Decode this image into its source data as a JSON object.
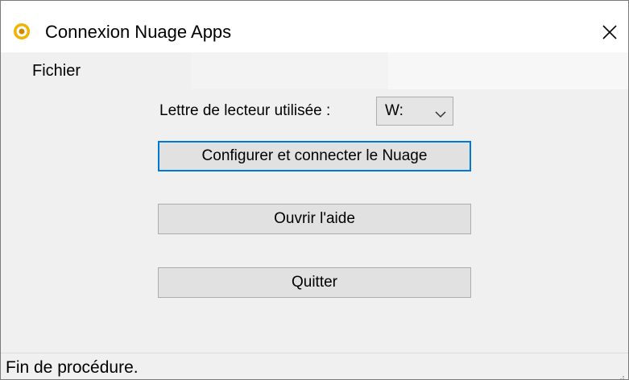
{
  "window": {
    "title": "Connexion Nuage Apps",
    "icon": "app-logo-icon",
    "close_icon": "close-icon"
  },
  "menu": {
    "items": [
      {
        "label": "Fichier"
      }
    ]
  },
  "drive": {
    "label": "Lettre de lecteur utilisée :",
    "selected": "W:"
  },
  "buttons": {
    "configure": "Configurer et connecter le Nuage",
    "help": "Ouvrir l'aide",
    "quit": "Quitter"
  },
  "status": {
    "text": "Fin de procédure."
  },
  "colors": {
    "accent": "#0078d7",
    "logo_primary": "#f0b400"
  }
}
